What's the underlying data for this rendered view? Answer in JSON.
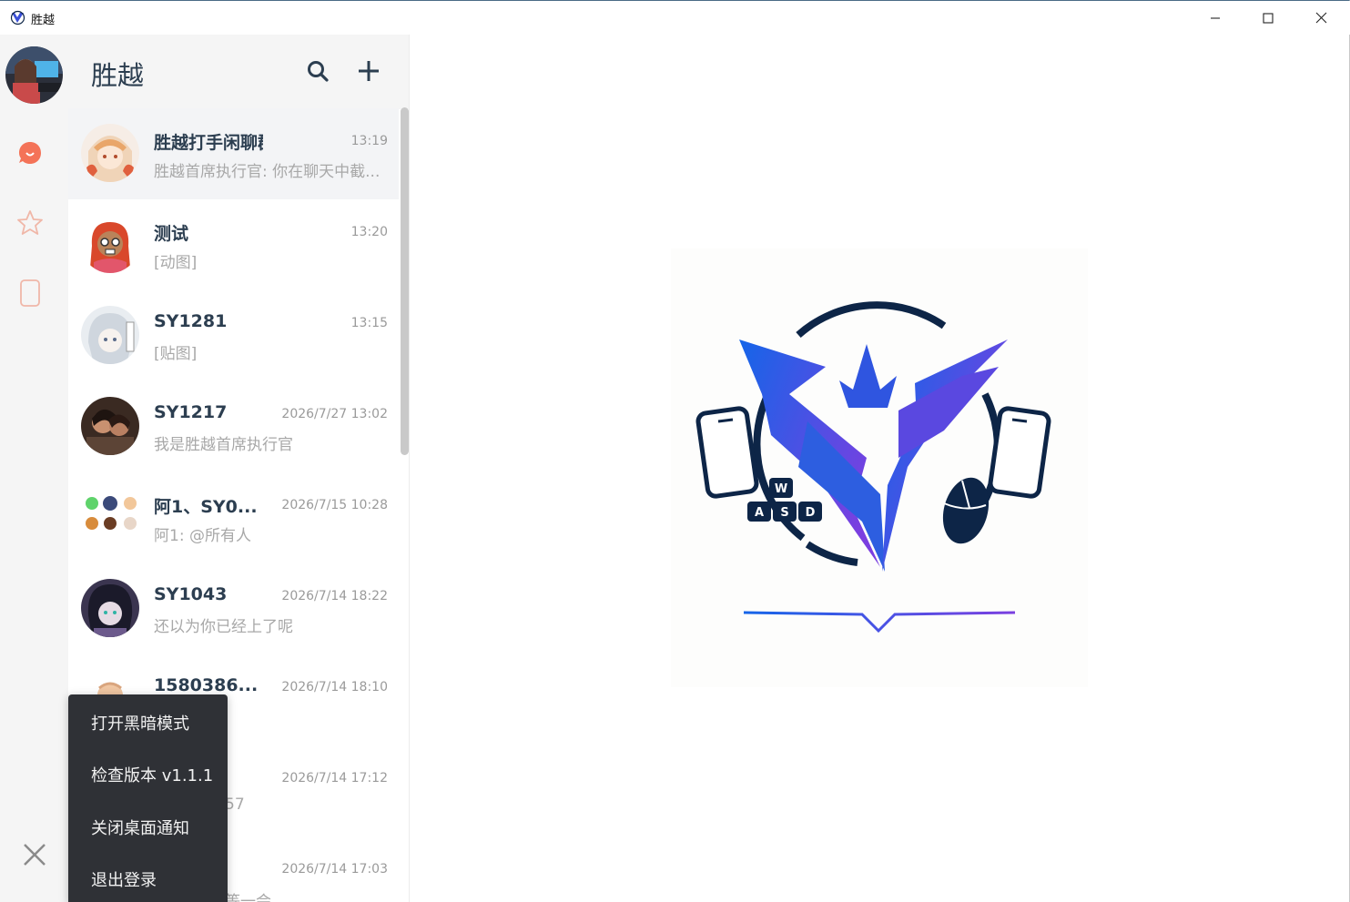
{
  "window": {
    "title": "胜越",
    "minimize_icon": "minimize-icon",
    "maximize_icon": "maximize-icon",
    "close_icon": "close-icon"
  },
  "sidebar": {
    "items": [
      {
        "icon": "chat-bubble-icon",
        "color": "#f47358"
      },
      {
        "icon": "star-icon",
        "color": "#f0b7a8"
      },
      {
        "icon": "phone-icon",
        "color": "#f0b7a8"
      }
    ],
    "close_icon": "close-icon"
  },
  "list": {
    "title": "胜越",
    "search_icon": "search-icon",
    "add_icon": "plus-icon",
    "chats": [
      {
        "name": "胜越打手闲聊群",
        "time": "13:19",
        "message": "胜越首席执行官: 你在聊天中截..."
      },
      {
        "name": "测试",
        "time": "13:20",
        "message": "[动图]"
      },
      {
        "name": "SY1281",
        "time": "13:15",
        "message": "[贴图]"
      },
      {
        "name": "SY1217",
        "time": "2026/7/27 13:02",
        "message": "我是胜越首席执行官"
      },
      {
        "name": "阿1、SY0...",
        "time": "2026/7/15 10:28",
        "message": "阿1: @所有人"
      },
      {
        "name": "SY1043",
        "time": "2026/7/14 18:22",
        "message": "还以为你已经上了呢"
      },
      {
        "name": "1580386...",
        "time": "2026/7/14 18:10",
        "message": ""
      },
      {
        "name": "",
        "time": "2026/7/14 17:12",
        "message": "57"
      },
      {
        "name": "",
        "time": "2026/7/14 17:03",
        "message": "等一会"
      }
    ]
  },
  "menu": {
    "items": [
      "打开黑暗模式",
      "检查版本 v1.1.1",
      "关闭桌面通知",
      "退出登录"
    ]
  },
  "logo": {
    "keys": [
      "W",
      "A",
      "S",
      "D"
    ],
    "gradient_start": "#1565e8",
    "gradient_end": "#7b3fe0",
    "ring_color": "#0d2547"
  }
}
